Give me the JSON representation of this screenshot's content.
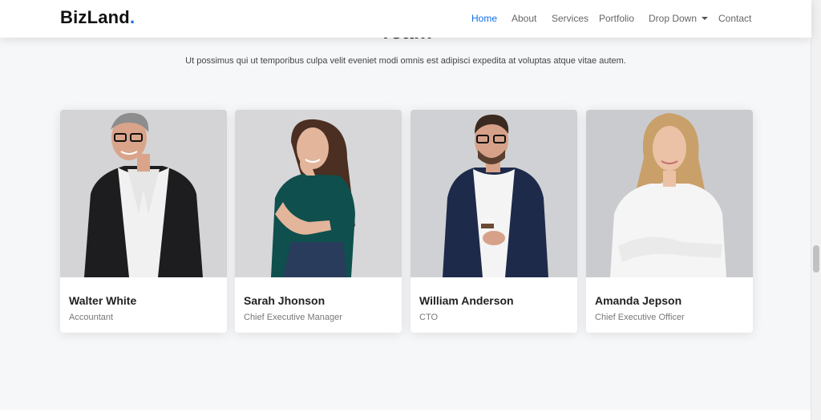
{
  "header": {
    "logo_text": "BizLand",
    "logo_dot": ".",
    "nav": [
      {
        "label": "Home",
        "active": true
      },
      {
        "label": "About"
      },
      {
        "label": "Services"
      },
      {
        "label": "Portfolio"
      },
      {
        "label": "Drop Down"
      },
      {
        "label": "Contact"
      }
    ]
  },
  "section": {
    "title": "Team",
    "description": "Ut possimus qui ut temporibus culpa velit eveniet modi omnis est adipisci expedita at voluptas atque vitae autem."
  },
  "team": [
    {
      "name": "Walter White",
      "role": "Accountant",
      "photo_icon": "man-suit-glasses-photo"
    },
    {
      "name": "Sarah Jhonson",
      "role": "Chief Executive Manager",
      "photo_icon": "woman-teal-shirt-photo"
    },
    {
      "name": "William Anderson",
      "role": "CTO",
      "photo_icon": "man-navy-blazer-coffee-photo"
    },
    {
      "name": "Amanda Jepson",
      "role": "Chief Executive Officer",
      "photo_icon": "woman-white-blouse-photo"
    }
  ],
  "colors": {
    "accent": "#106eea",
    "background": "#f6f7f9"
  }
}
